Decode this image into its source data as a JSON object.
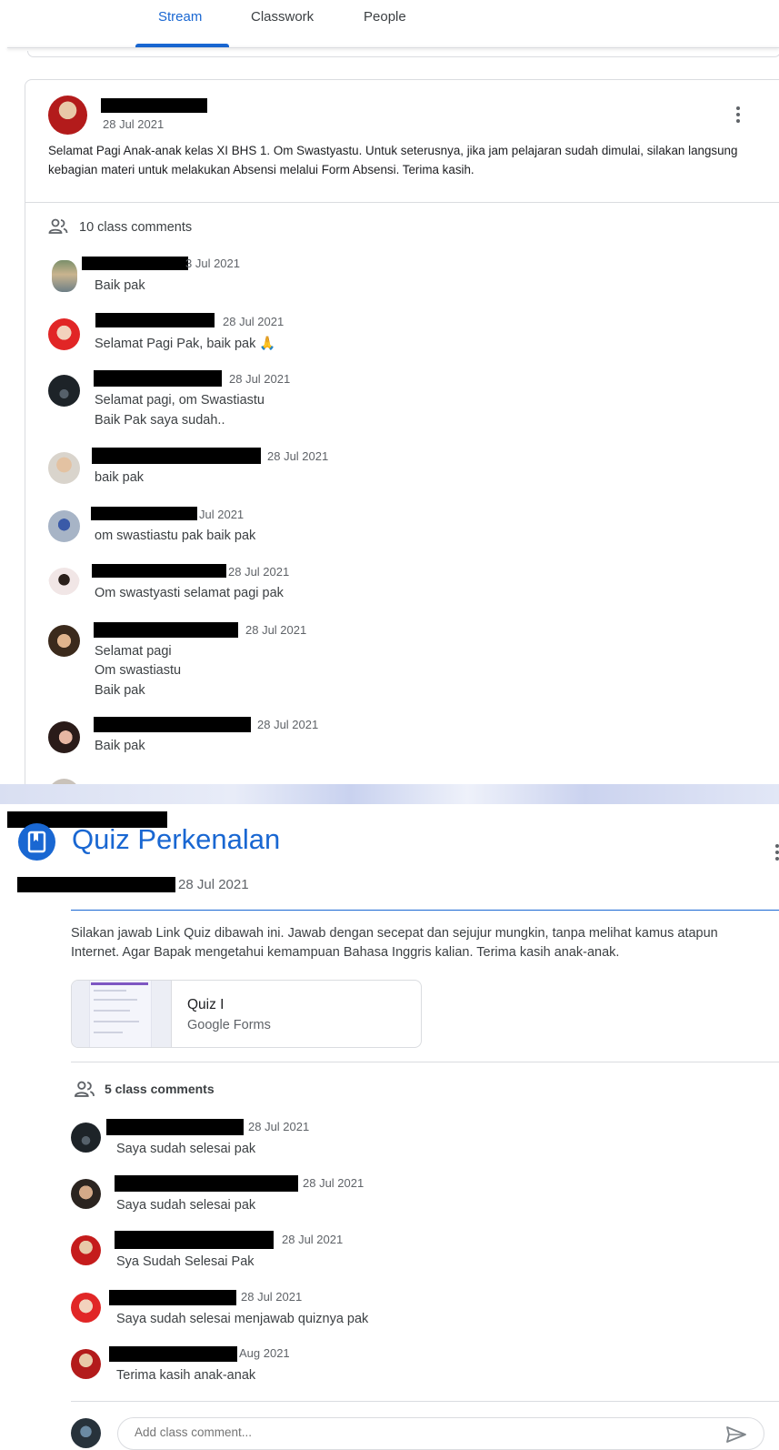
{
  "nav": {
    "tabs": [
      {
        "label": "Stream"
      },
      {
        "label": "Classwork"
      },
      {
        "label": "People"
      }
    ]
  },
  "post1": {
    "date": "28 Jul 2021",
    "text": "Selamat Pagi Anak-anak kelas XI BHS 1. Om Swastyastu. Untuk seterusnya, jika jam pelajaran sudah dimulai, silakan langsung kebagian materi untuk melakukan Absensi melalui Form Absensi. Terima kasih.",
    "comments_count_label": "10 class comments",
    "comments": [
      {
        "date": "3 Jul 2021",
        "lines": [
          "Baik pak"
        ]
      },
      {
        "date": "28 Jul 2021",
        "lines": [
          "Selamat Pagi Pak, baik pak 🙏"
        ]
      },
      {
        "date": "28 Jul 2021",
        "lines": [
          "Selamat pagi, om Swastiastu",
          "Baik Pak saya sudah.."
        ]
      },
      {
        "date": "28 Jul 2021",
        "lines": [
          "baik pak"
        ]
      },
      {
        "date": "Jul 2021",
        "lines": [
          "om swastiastu  pak baik pak"
        ]
      },
      {
        "date": "28 Jul 2021",
        "lines": [
          "Om swastyasti selamat pagi pak"
        ]
      },
      {
        "date": "28 Jul 2021",
        "lines": [
          "Selamat pagi",
          "Om swastiastu",
          "Baik pak"
        ]
      },
      {
        "date": "28 Jul 2021",
        "lines": [
          "Baik pak"
        ]
      }
    ]
  },
  "quiz": {
    "title": "Quiz Perkenalan",
    "date": "28 Jul 2021",
    "description": "Silakan jawab Link Quiz dibawah ini. Jawab dengan secepat dan sejujur mungkin, tanpa melihat kamus atapun Internet. Agar Bapak mengetahui kemampuan Bahasa Inggris kalian. Terima kasih anak-anak.",
    "attachment": {
      "title": "Quiz I",
      "subtitle": "Google Forms"
    },
    "comments_count_label": "5 class comments",
    "comments": [
      {
        "date": "28 Jul 2021",
        "text": "Saya sudah selesai pak"
      },
      {
        "date": "28 Jul 2021",
        "text": "Saya sudah selesai pak"
      },
      {
        "date": "28 Jul 2021",
        "text": "Sya Sudah Selesai Pak"
      },
      {
        "date": "28 Jul 2021",
        "text": "Saya sudah selesai menjawab quiznya pak"
      },
      {
        "date": "Aug 2021",
        "text": "Terima kasih anak-anak"
      }
    ],
    "add_comment_placeholder": "Add class comment..."
  },
  "colors": {
    "accent": "#1967d2",
    "text": "#202124",
    "secondary": "#5f6368",
    "border": "#dadce0"
  },
  "icons": [
    "more-vert-icon",
    "people-icon",
    "assignment-icon",
    "send-icon"
  ]
}
